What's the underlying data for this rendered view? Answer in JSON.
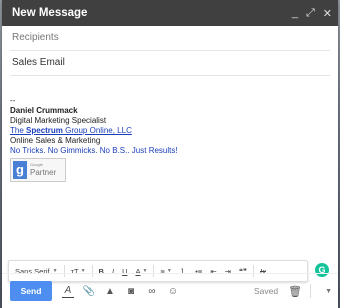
{
  "window": {
    "title": "New Message",
    "controls": [
      "_",
      "⤢",
      "✕"
    ]
  },
  "recipients": {
    "placeholder": "Recipients"
  },
  "subject": {
    "value": "Sales Email"
  },
  "signature": {
    "dash": "--",
    "name": "Daniel Crummack",
    "role": "Digital Marketing Specialist",
    "company_prefix": "The ",
    "company_bold": "Spectrum",
    "company_suffix": " Group Online, LLC",
    "line4": "Online Sales & Marketing",
    "tagline": "No Tricks. No Gimmicks. No B.S.. Just Results!"
  },
  "badge": {
    "letter": "g",
    "small": "Google",
    "label": "Partner"
  },
  "formatting": {
    "font": "Sans Serif",
    "size_icon": "тT",
    "bold": "B",
    "italic": "I",
    "underline": "U",
    "text_color": "A",
    "align": "≡",
    "numbered": "⒈",
    "bulleted": "•≡",
    "indent_less": "⇤",
    "indent_more": "⇥",
    "quote": "❝❞",
    "clear": "Ix"
  },
  "grammarly": {
    "letter": "G"
  },
  "bottom": {
    "send": "Send",
    "format_icon": "A",
    "attach_icon": "📎",
    "drive_icon": "▲",
    "photo_icon": "◙",
    "link_icon": "∞",
    "emoji_icon": "☺",
    "saved": "Saved",
    "trash_icon": "🗑",
    "more_icon": "▼"
  },
  "colors": {
    "titlebar": "#404040",
    "send": "#4d8ef0",
    "link": "#1a3ebb",
    "grammarly": "#15c39a"
  }
}
